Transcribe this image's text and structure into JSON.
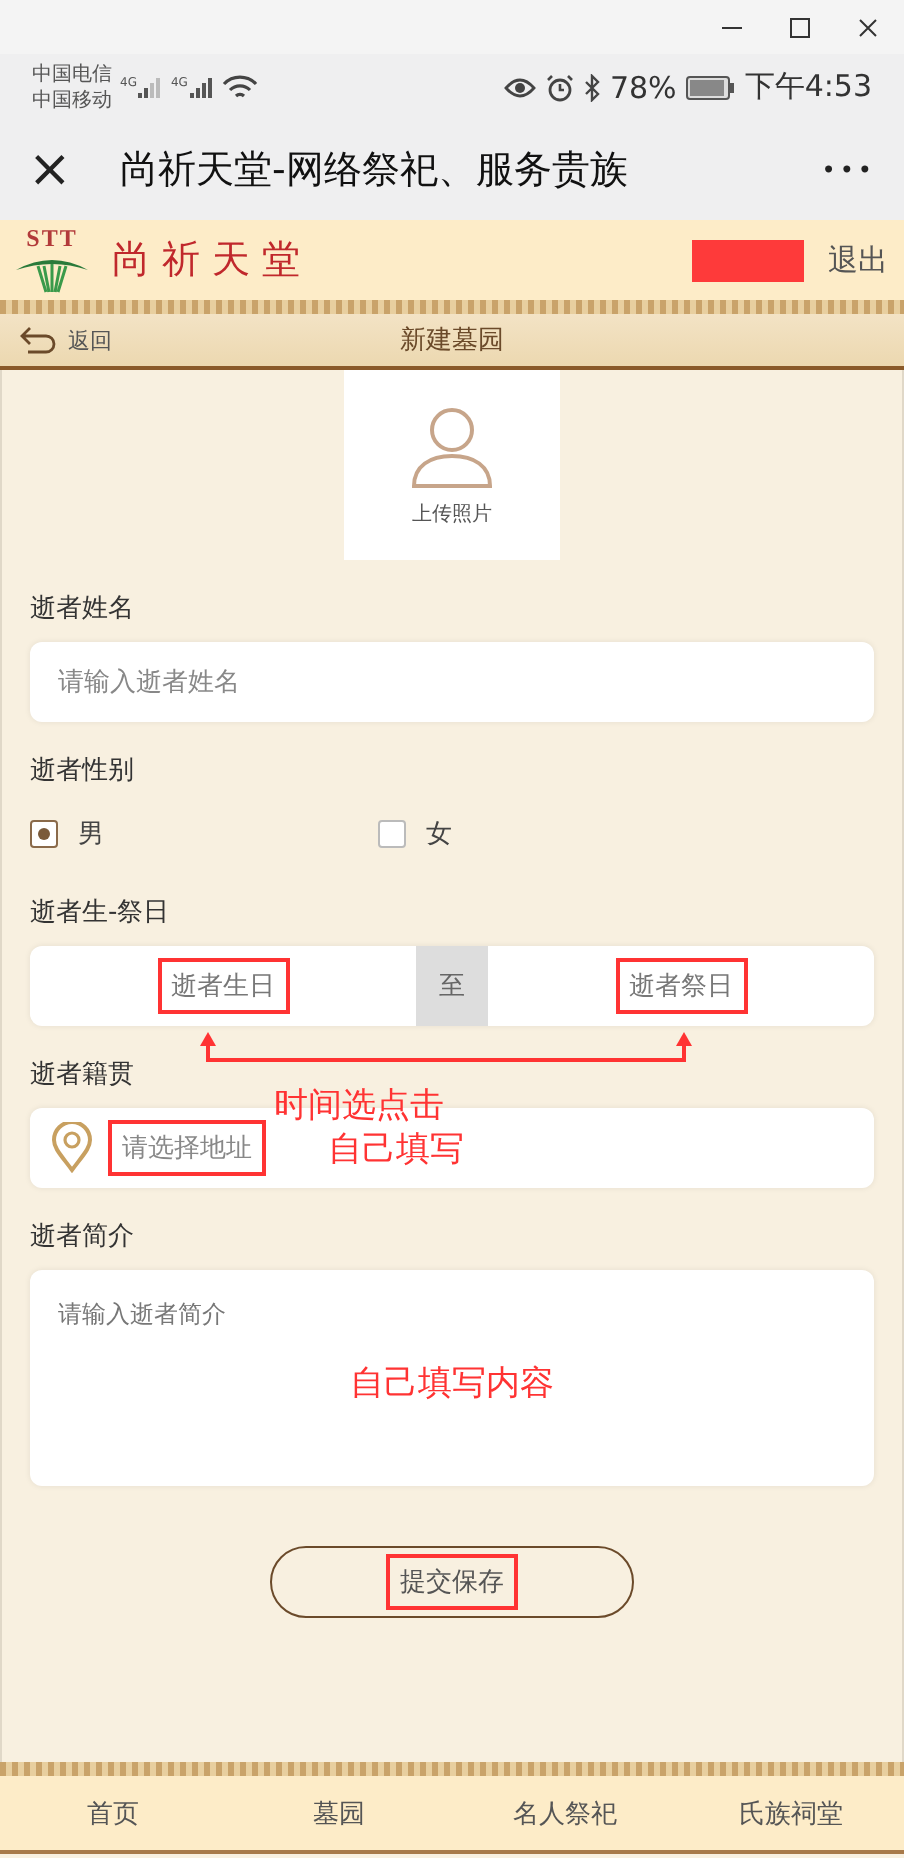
{
  "status_bar": {
    "carriers": [
      "中国电信",
      "中国移动"
    ],
    "network_labels": [
      "4G",
      "4G"
    ],
    "battery": "78%",
    "time": "下午4:53"
  },
  "nav_bar": {
    "title": "尚祈天堂-网络祭祀、服务贵族",
    "close": "×",
    "more": "•••"
  },
  "site_header": {
    "logo_mark": "STT",
    "logo_text": "尚祈天堂",
    "logout": "退出"
  },
  "page_header": {
    "back": "返回",
    "title": "新建墓园"
  },
  "photo": {
    "label": "上传照片"
  },
  "form": [
    {
      "kind": "input",
      "label": "逝者姓名",
      "placeholder": "请输入逝者姓名"
    },
    {
      "kind": "radio",
      "label": "逝者性别",
      "options": [
        {
          "label": "男",
          "selected": true
        },
        {
          "label": "女",
          "selected": false
        }
      ]
    },
    {
      "kind": "dates",
      "label": "逝者生-祭日",
      "from": {
        "placeholder": "逝者生日",
        "annotated": true
      },
      "separator": "至",
      "to": {
        "placeholder": "逝者祭日",
        "annotated": true
      },
      "note": "时间选点击"
    },
    {
      "kind": "address",
      "label": "逝者籍贯",
      "placeholder": "请选择地址",
      "annotated": true,
      "note": "自己填写"
    },
    {
      "kind": "textarea",
      "label": "逝者简介",
      "placeholder": "请输入逝者简介",
      "note": "自己填写内容"
    }
  ],
  "submit": {
    "label": "提交保存",
    "annotated": true
  },
  "tab_bar": [
    {
      "label": "首页"
    },
    {
      "label": "墓园"
    },
    {
      "label": "名人祭祀"
    },
    {
      "label": "氏族祠堂"
    }
  ]
}
